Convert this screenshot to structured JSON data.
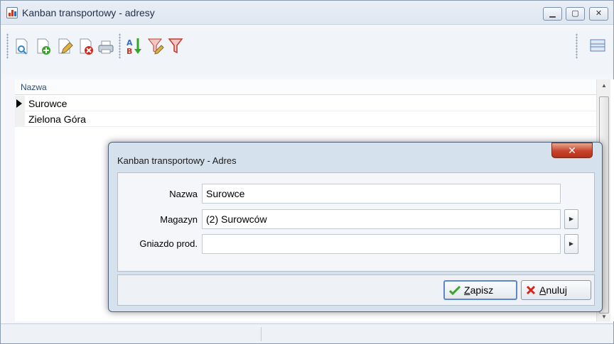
{
  "window": {
    "title": "Kanban transportowy - adresy"
  },
  "toolbar": {
    "icons": [
      "preview-icon",
      "add-icon",
      "edit-icon",
      "delete-icon",
      "print-icon",
      "sort-az-icon",
      "filter-edit-icon",
      "filter-icon",
      "layout-icon"
    ]
  },
  "grid": {
    "column_header": "Nazwa",
    "rows": [
      "Surowce",
      "Zielona Góra"
    ]
  },
  "dialog": {
    "title": "Kanban transportowy - Adres",
    "close_glyph": "✕",
    "fields": {
      "nazwa": {
        "label": "Nazwa",
        "value": "Surowce"
      },
      "magazyn": {
        "label": "Magazyn",
        "value": "(2) Surowców"
      },
      "gniazdo": {
        "label": "Gniazdo prod.",
        "value": ""
      }
    },
    "buttons": {
      "save_underline": "Z",
      "save_rest": "apisz",
      "cancel_underline": "A",
      "cancel_rest": "nuluj"
    }
  },
  "colors": {
    "accent": "#5c87c8",
    "close": "#c8432b",
    "check": "#3aa52c",
    "cross": "#d3261b"
  }
}
